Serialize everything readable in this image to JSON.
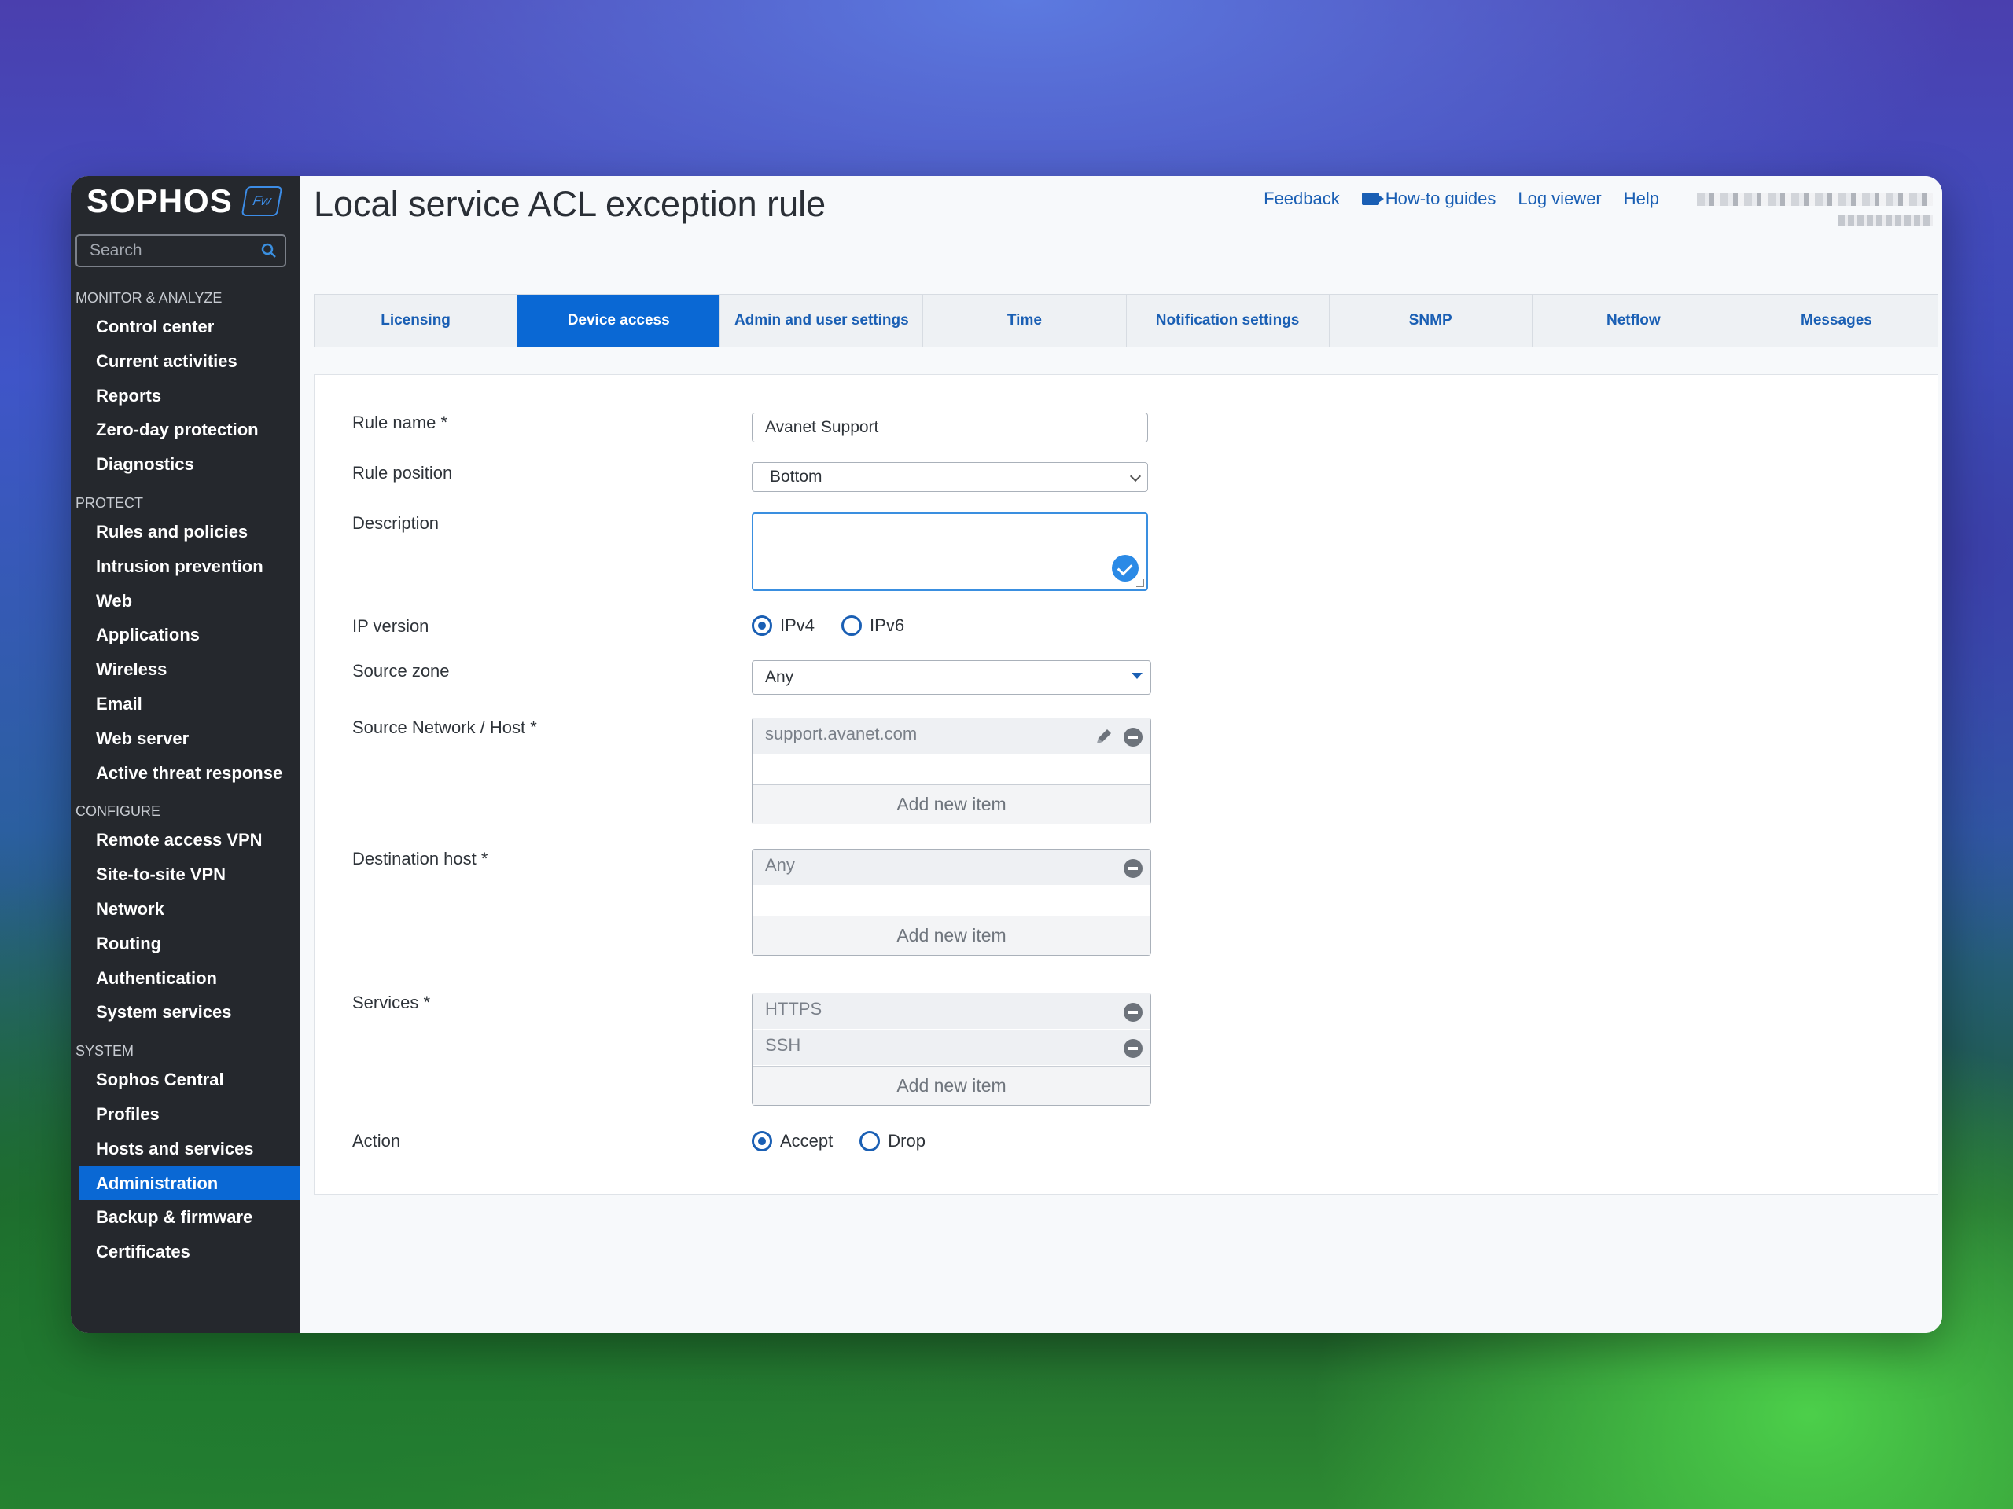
{
  "sidebar": {
    "brand": "SOPHOS",
    "badge": "Fw",
    "search_placeholder": "Search",
    "sections": [
      {
        "title": "MONITOR & ANALYZE",
        "items": [
          "Control center",
          "Current activities",
          "Reports",
          "Zero-day protection",
          "Diagnostics"
        ]
      },
      {
        "title": "PROTECT",
        "items": [
          "Rules and policies",
          "Intrusion prevention",
          "Web",
          "Applications",
          "Wireless",
          "Email",
          "Web server",
          "Active threat response"
        ]
      },
      {
        "title": "CONFIGURE",
        "items": [
          "Remote access VPN",
          "Site-to-site VPN",
          "Network",
          "Routing",
          "Authentication",
          "System services"
        ]
      },
      {
        "title": "SYSTEM",
        "items": [
          "Sophos Central",
          "Profiles",
          "Hosts and services",
          "Administration",
          "Backup & firmware",
          "Certificates"
        ]
      }
    ],
    "active_item": "Administration"
  },
  "header": {
    "title": "Local service ACL exception rule",
    "links": {
      "feedback": "Feedback",
      "howto": "How-to guides",
      "logviewer": "Log viewer",
      "help": "Help"
    }
  },
  "tabs": [
    "Licensing",
    "Device access",
    "Admin and user settings",
    "Time",
    "Notification settings",
    "SNMP",
    "Netflow",
    "Messages"
  ],
  "active_tab": "Device access",
  "form": {
    "rule_name": {
      "label": "Rule name *",
      "value": "Avanet Support"
    },
    "rule_position": {
      "label": "Rule position",
      "value": "Bottom"
    },
    "description": {
      "label": "Description",
      "value": ""
    },
    "ip_version": {
      "label": "IP version",
      "options": [
        "IPv4",
        "IPv6"
      ],
      "selected": "IPv4"
    },
    "source_zone": {
      "label": "Source zone",
      "value": "Any"
    },
    "source_network": {
      "label": "Source Network / Host *",
      "items": [
        "support.avanet.com"
      ],
      "add_label": "Add new item"
    },
    "destination_host": {
      "label": "Destination host *",
      "items": [
        "Any"
      ],
      "add_label": "Add new item"
    },
    "services": {
      "label": "Services *",
      "items": [
        "HTTPS",
        "SSH"
      ],
      "add_label": "Add new item"
    },
    "action": {
      "label": "Action",
      "options": [
        "Accept",
        "Drop"
      ],
      "selected": "Accept"
    }
  },
  "colors": {
    "accent": "#0a68d4",
    "link": "#1a5fb4",
    "sidebar_bg": "#25282d"
  }
}
